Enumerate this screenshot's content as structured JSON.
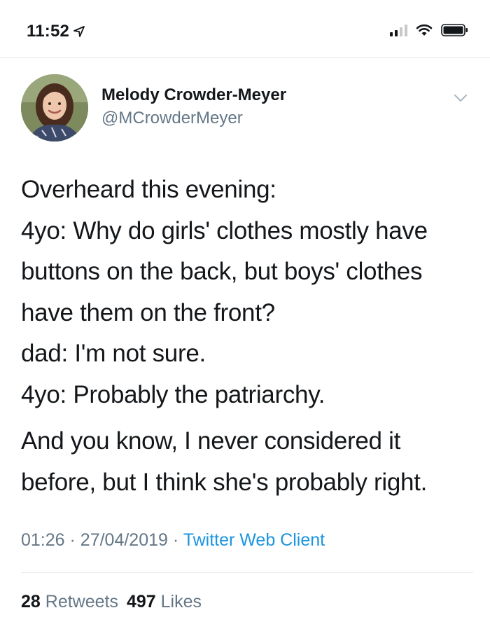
{
  "status_bar": {
    "time": "11:52",
    "icons": [
      "location-arrow-icon",
      "cellular-signal-icon",
      "wifi-icon",
      "battery-icon"
    ]
  },
  "tweet": {
    "author": {
      "name": "Melody Crowder-Meyer",
      "handle": "@MCrowderMeyer",
      "avatar_icon": "profile-photo"
    },
    "paragraphs": [
      [
        "Overheard this evening:",
        "4yo: Why do girls' clothes mostly have",
        "buttons on the back, but boys' clothes",
        "have them on the front?",
        "dad: I'm not sure.",
        "4yo: Probably the patriarchy."
      ],
      [
        "And you know, I never considered it",
        "before, but I think she's probably right."
      ]
    ],
    "time": "01:26",
    "date": "27/04/2019",
    "separator": "·",
    "client": "Twitter Web Client",
    "retweets_count": "28",
    "retweets_label": "Retweets",
    "likes_count": "497",
    "likes_label": "Likes"
  },
  "colors": {
    "text": "#14171a",
    "secondary": "#657786",
    "link": "#1b95e0",
    "divider": "#e6ecf0"
  }
}
